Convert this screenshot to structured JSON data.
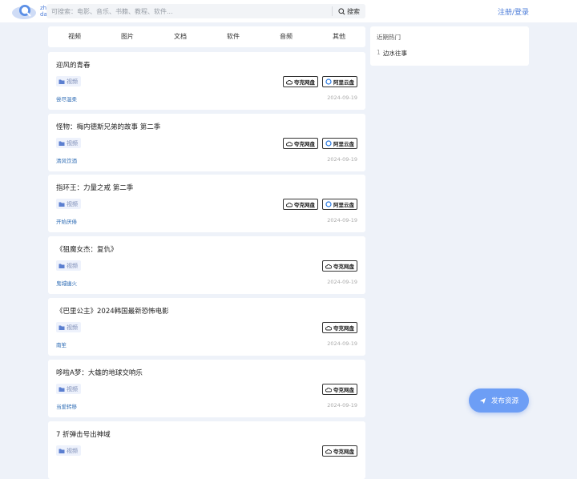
{
  "header": {
    "logo_text": "zh da",
    "search_placeholder": "可搜索：电影、音乐、书籍、教程、软件...",
    "search_button": "搜索",
    "login_link": "注册/登录"
  },
  "categories": [
    "视频",
    "图片",
    "文档",
    "软件",
    "音频",
    "其他"
  ],
  "sidebar": {
    "title": "近期热门",
    "items": [
      {
        "rank": "1",
        "label": "边水往事"
      }
    ]
  },
  "posts": [
    {
      "title": "迎风的青春",
      "tag": "视频",
      "author": "尝尽温柔",
      "date": "2024-09-19",
      "quark": "夸克网盘",
      "aliyun": "阿里云盘"
    },
    {
      "title": "怪物：梅内德斯兄弟的故事 第二季",
      "tag": "视频",
      "author": "清风饮酒",
      "date": "2024-09-19",
      "quark": "夸克网盘",
      "aliyun": "阿里云盘"
    },
    {
      "title": "指环王：力量之戒 第二季",
      "tag": "视频",
      "author": "开始厌倦",
      "date": "2024-09-19",
      "quark": "夸克网盘",
      "aliyun": "阿里云盘"
    },
    {
      "title": "《狙魔女杰：复仇》",
      "tag": "视频",
      "author": "鬼城幽火",
      "date": "2024-09-19",
      "quark": "夸克网盘",
      "aliyun": null
    },
    {
      "title": "《巴里公主》2024韩国最新恐怖电影",
      "tag": "视频",
      "author": "南笙",
      "date": "2024-09-19",
      "quark": "夸克网盘",
      "aliyun": null
    },
    {
      "title": "哆啦A梦：大雄的地球交响乐",
      "tag": "视频",
      "author": "当爱转移",
      "date": "2024-09-19",
      "quark": "夸克网盘",
      "aliyun": null
    },
    {
      "title": "7 折弹击号出神域",
      "tag": "视频",
      "author": "",
      "date": "",
      "quark": "夸克网盘",
      "aliyun": null
    }
  ],
  "publish_button": "发布资源",
  "colors": {
    "accent": "#4a7bd8",
    "page_bg": "#eef2f9",
    "author_link": "#2e6cb5",
    "publish_bg": "#6d9ef5"
  }
}
